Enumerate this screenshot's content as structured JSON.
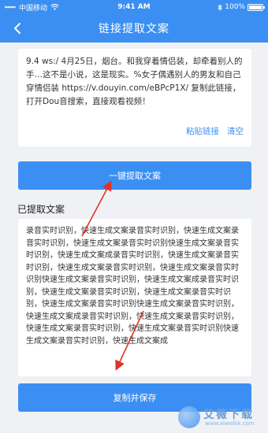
{
  "status_bar": {
    "carrier": "中国移动",
    "time": "9:41 AM",
    "battery": "100%"
  },
  "nav": {
    "title": "链接提取文案"
  },
  "input": {
    "text": "9.4 ws:/ 4月25日，烟台。和我穿着情侣装，却牵着别人的手…这不是小说，这是现实。%女子偶遇别人的男友和自己穿情侣装 https://v.douyin.com/eBPcP1X/ 复制此链接，打开Dou音搜索，直接观看视频！",
    "paste_label": "粘贴链接",
    "clear_label": "清空"
  },
  "extract_button": {
    "label": "一键提取文案"
  },
  "result": {
    "heading": "已提取文案",
    "text": "录音实时识别，快速生成文案录音实时识别，快速生成文案录音实时识别，快速生成文案录音实时识别快速生成文案录音实时识别，快速生成文案成录音实时识别，快速生成文案录音实时识别，快速生成文案录音实时识别，快速生成文案录音实时识别快速生成文案录音实时识别，快速生成文案成录音实时识别，快速生成文案录音实时识别，快速生成文案录音实时识别，快速生成文案录音实时识别快速生成文案录音实时识别，快速生成文案成录音实时识别，快速生成文案录音实时识别，快速生成文案录音实时识别，快速生成文案录音实时识别快速生成文案录音实时识别，快速生成文案成"
  },
  "save_button": {
    "label": "复制并保存"
  },
  "watermark": {
    "name": "艾薇下载",
    "url": "www.aiweibk.com"
  },
  "colors": {
    "accent": "#3b8ff2",
    "arrow": "#e0332a"
  }
}
